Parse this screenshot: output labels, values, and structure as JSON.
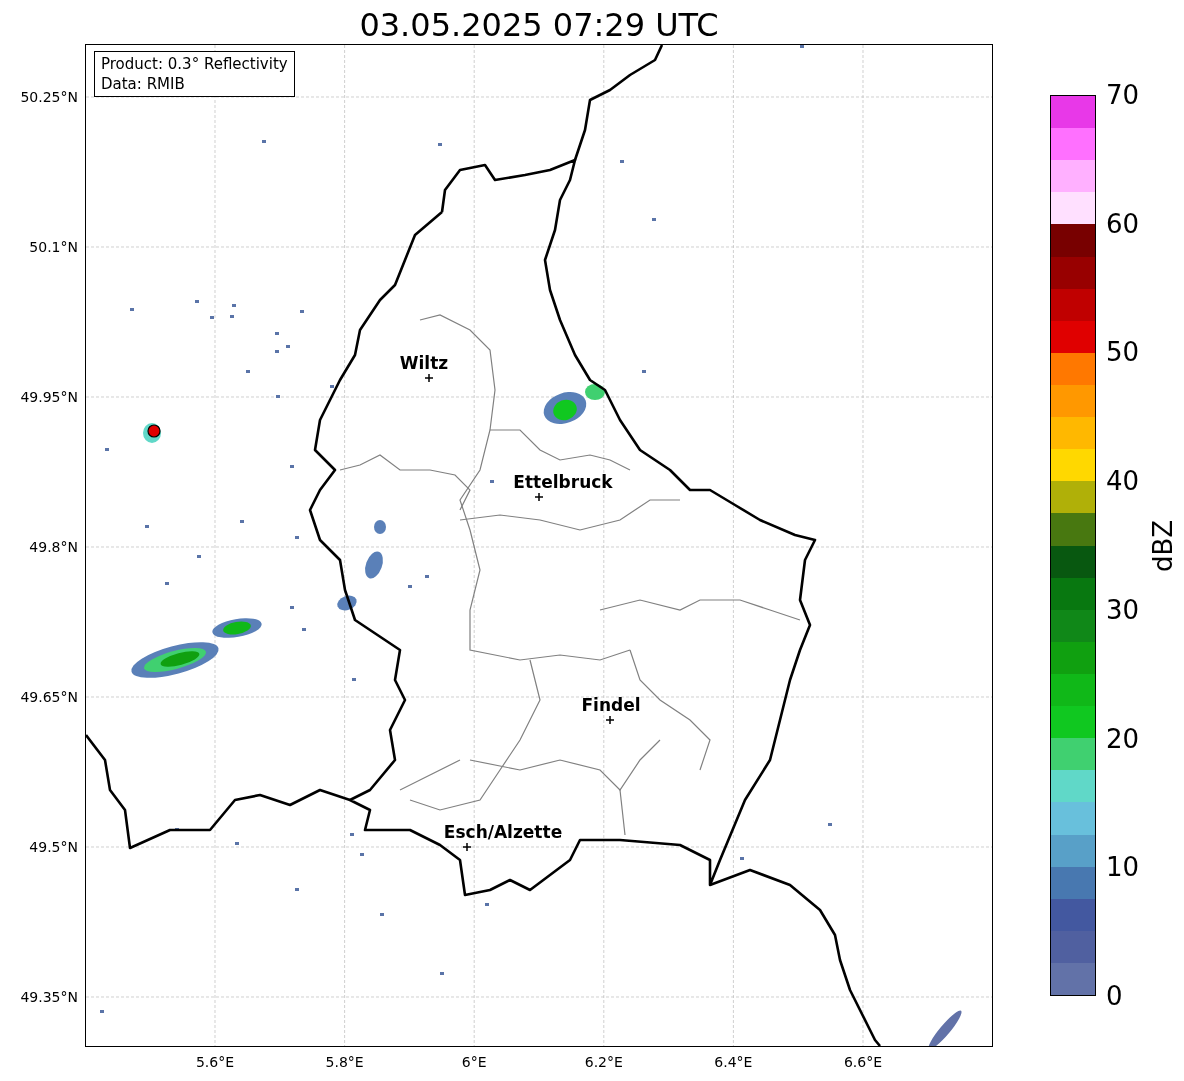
{
  "title": "03.05.2025 07:29 UTC",
  "legend": {
    "lines": [
      "Product: 0.3° Reflectivity",
      "Data: RMIB"
    ]
  },
  "map": {
    "cities": [
      {
        "name": "Wiltz"
      },
      {
        "name": "Ettelbruck"
      },
      {
        "name": "Findel"
      },
      {
        "name": "Esch/Alzette"
      }
    ],
    "x_ticks": [
      "5.6°E",
      "5.8°E",
      "6°E",
      "6.2°E",
      "6.4°E",
      "6.6°E"
    ],
    "y_ticks": [
      "50.25°N",
      "50.1°N",
      "49.95°N",
      "49.8°N",
      "49.65°N",
      "49.5°N",
      "49.35°N"
    ]
  },
  "colorbar": {
    "label": "dBZ",
    "ticks": [
      "70",
      "60",
      "50",
      "40",
      "30",
      "20",
      "10",
      "0"
    ],
    "bins": [
      {
        "color": "#e838e8"
      },
      {
        "color": "#ff70ff"
      },
      {
        "color": "#ffb0ff"
      },
      {
        "color": "#ffe0ff"
      },
      {
        "color": "#780000"
      },
      {
        "color": "#980000"
      },
      {
        "color": "#c00000"
      },
      {
        "color": "#e00000"
      },
      {
        "color": "#ff7800"
      },
      {
        "color": "#ff9800"
      },
      {
        "color": "#ffb800"
      },
      {
        "color": "#ffd800"
      },
      {
        "color": "#b0b008"
      },
      {
        "color": "#487810"
      },
      {
        "color": "#085810"
      },
      {
        "color": "#087810"
      },
      {
        "color": "#108818"
      },
      {
        "color": "#10a010"
      },
      {
        "color": "#10b818"
      },
      {
        "color": "#10c820"
      },
      {
        "color": "#40d070"
      },
      {
        "color": "#60d8c8"
      },
      {
        "color": "#68c0dc"
      },
      {
        "color": "#58a0c8"
      },
      {
        "color": "#4878b0"
      },
      {
        "color": "#4358a0"
      },
      {
        "color": "#5060a0"
      },
      {
        "color": "#6272a8"
      }
    ]
  }
}
